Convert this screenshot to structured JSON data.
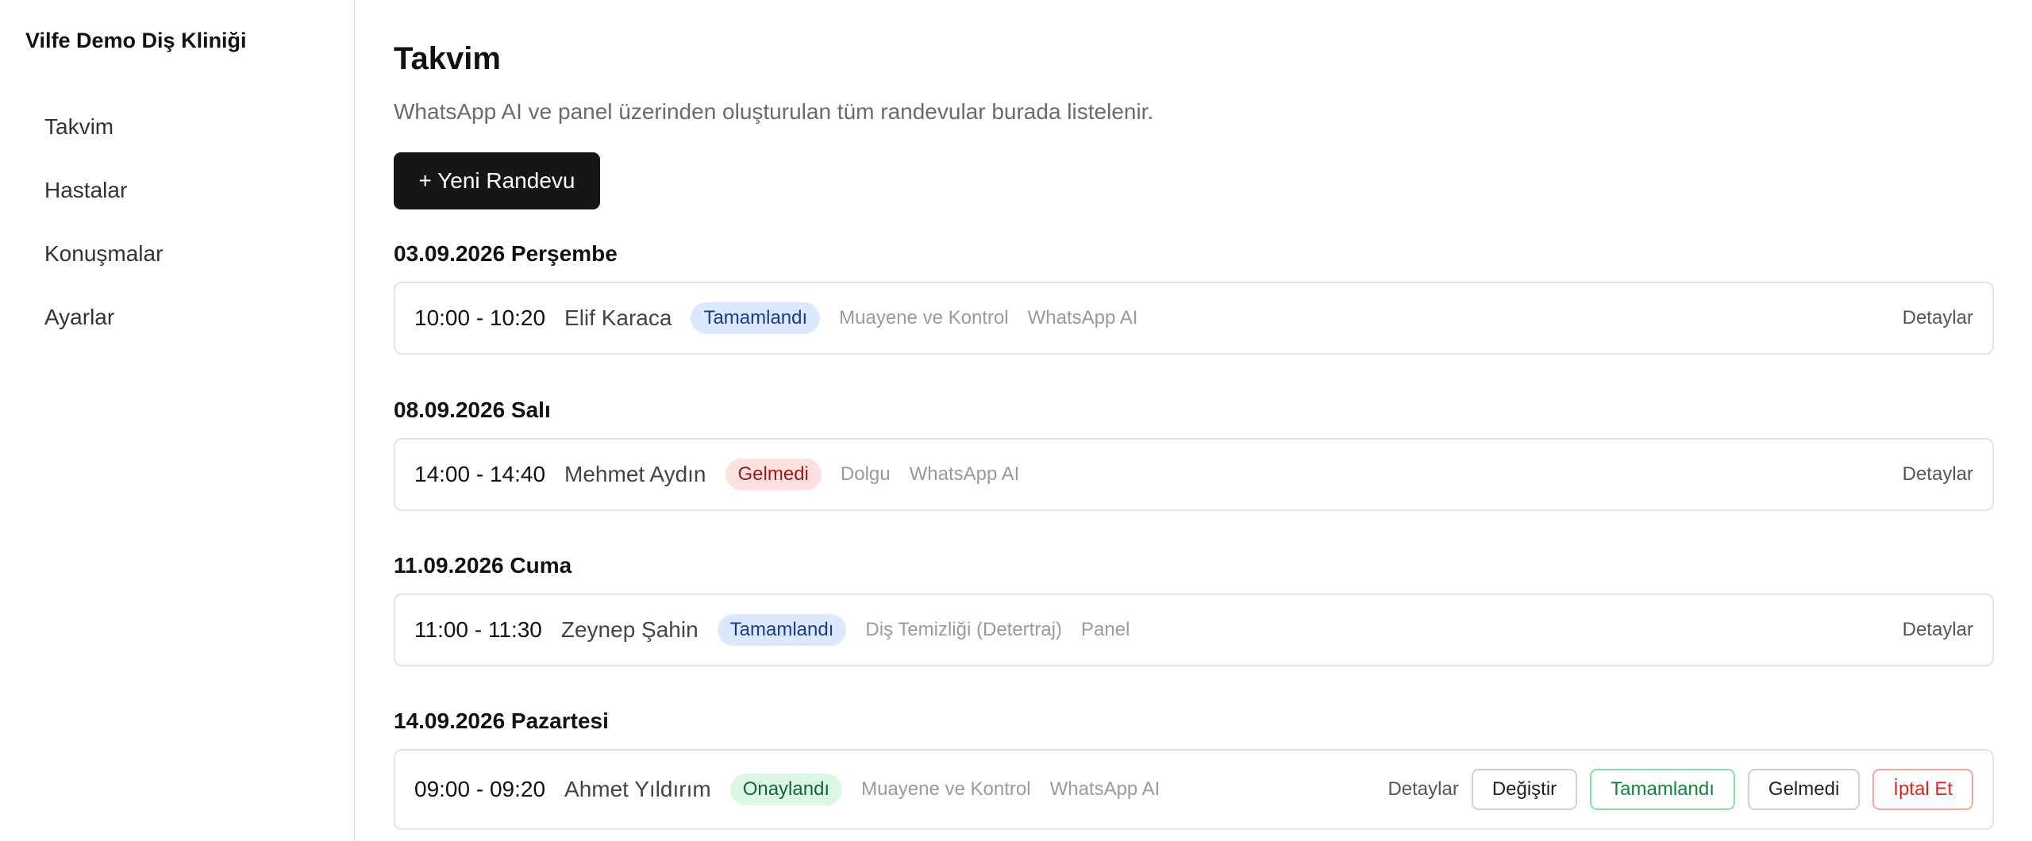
{
  "sidebar": {
    "brand": "Vilfe Demo Diş Kliniği",
    "items": [
      {
        "label": "Takvim"
      },
      {
        "label": "Hastalar"
      },
      {
        "label": "Konuşmalar"
      },
      {
        "label": "Ayarlar"
      }
    ]
  },
  "header": {
    "title": "Takvim",
    "subtitle": "WhatsApp AI ve panel üzerinden oluşturulan tüm randevular burada listelenir.",
    "new_button": "+ Yeni Randevu"
  },
  "days": [
    {
      "heading": "03.09.2026 Perşembe",
      "appointment": {
        "time": "10:00 - 10:20",
        "patient": "Elif Karaca",
        "status": "Tamamlandı",
        "status_color": "#dbe8fd",
        "treatment": "Muayene ve Kontrol",
        "source": "WhatsApp AI",
        "details": "Detaylar"
      }
    },
    {
      "heading": "08.09.2026 Salı",
      "appointment": {
        "time": "14:00 - 14:40",
        "patient": "Mehmet Aydın",
        "status": "Gelmedi",
        "status_color": "#fde0e0",
        "treatment": "Dolgu",
        "source": "WhatsApp AI",
        "details": "Detaylar"
      }
    },
    {
      "heading": "11.09.2026 Cuma",
      "appointment": {
        "time": "11:00 - 11:30",
        "patient": "Zeynep Şahin",
        "status": "Tamamlandı",
        "status_color": "#dbe8fd",
        "treatment": "Diş Temizliği (Detertraj)",
        "source": "Panel",
        "details": "Detaylar"
      }
    },
    {
      "heading": "14.09.2026 Pazartesi",
      "appointment": {
        "time": "09:00 - 09:20",
        "patient": "Ahmet Yıldırım",
        "status": "Onaylandı",
        "status_color": "#dcf7e5",
        "treatment": "Muayene ve Kontrol",
        "source": "WhatsApp AI",
        "details": "Detaylar",
        "actions": {
          "change": "Değiştir",
          "complete": "Tamamlandı",
          "no_show": "Gelmedi",
          "cancel": "İptal Et"
        }
      }
    }
  ]
}
